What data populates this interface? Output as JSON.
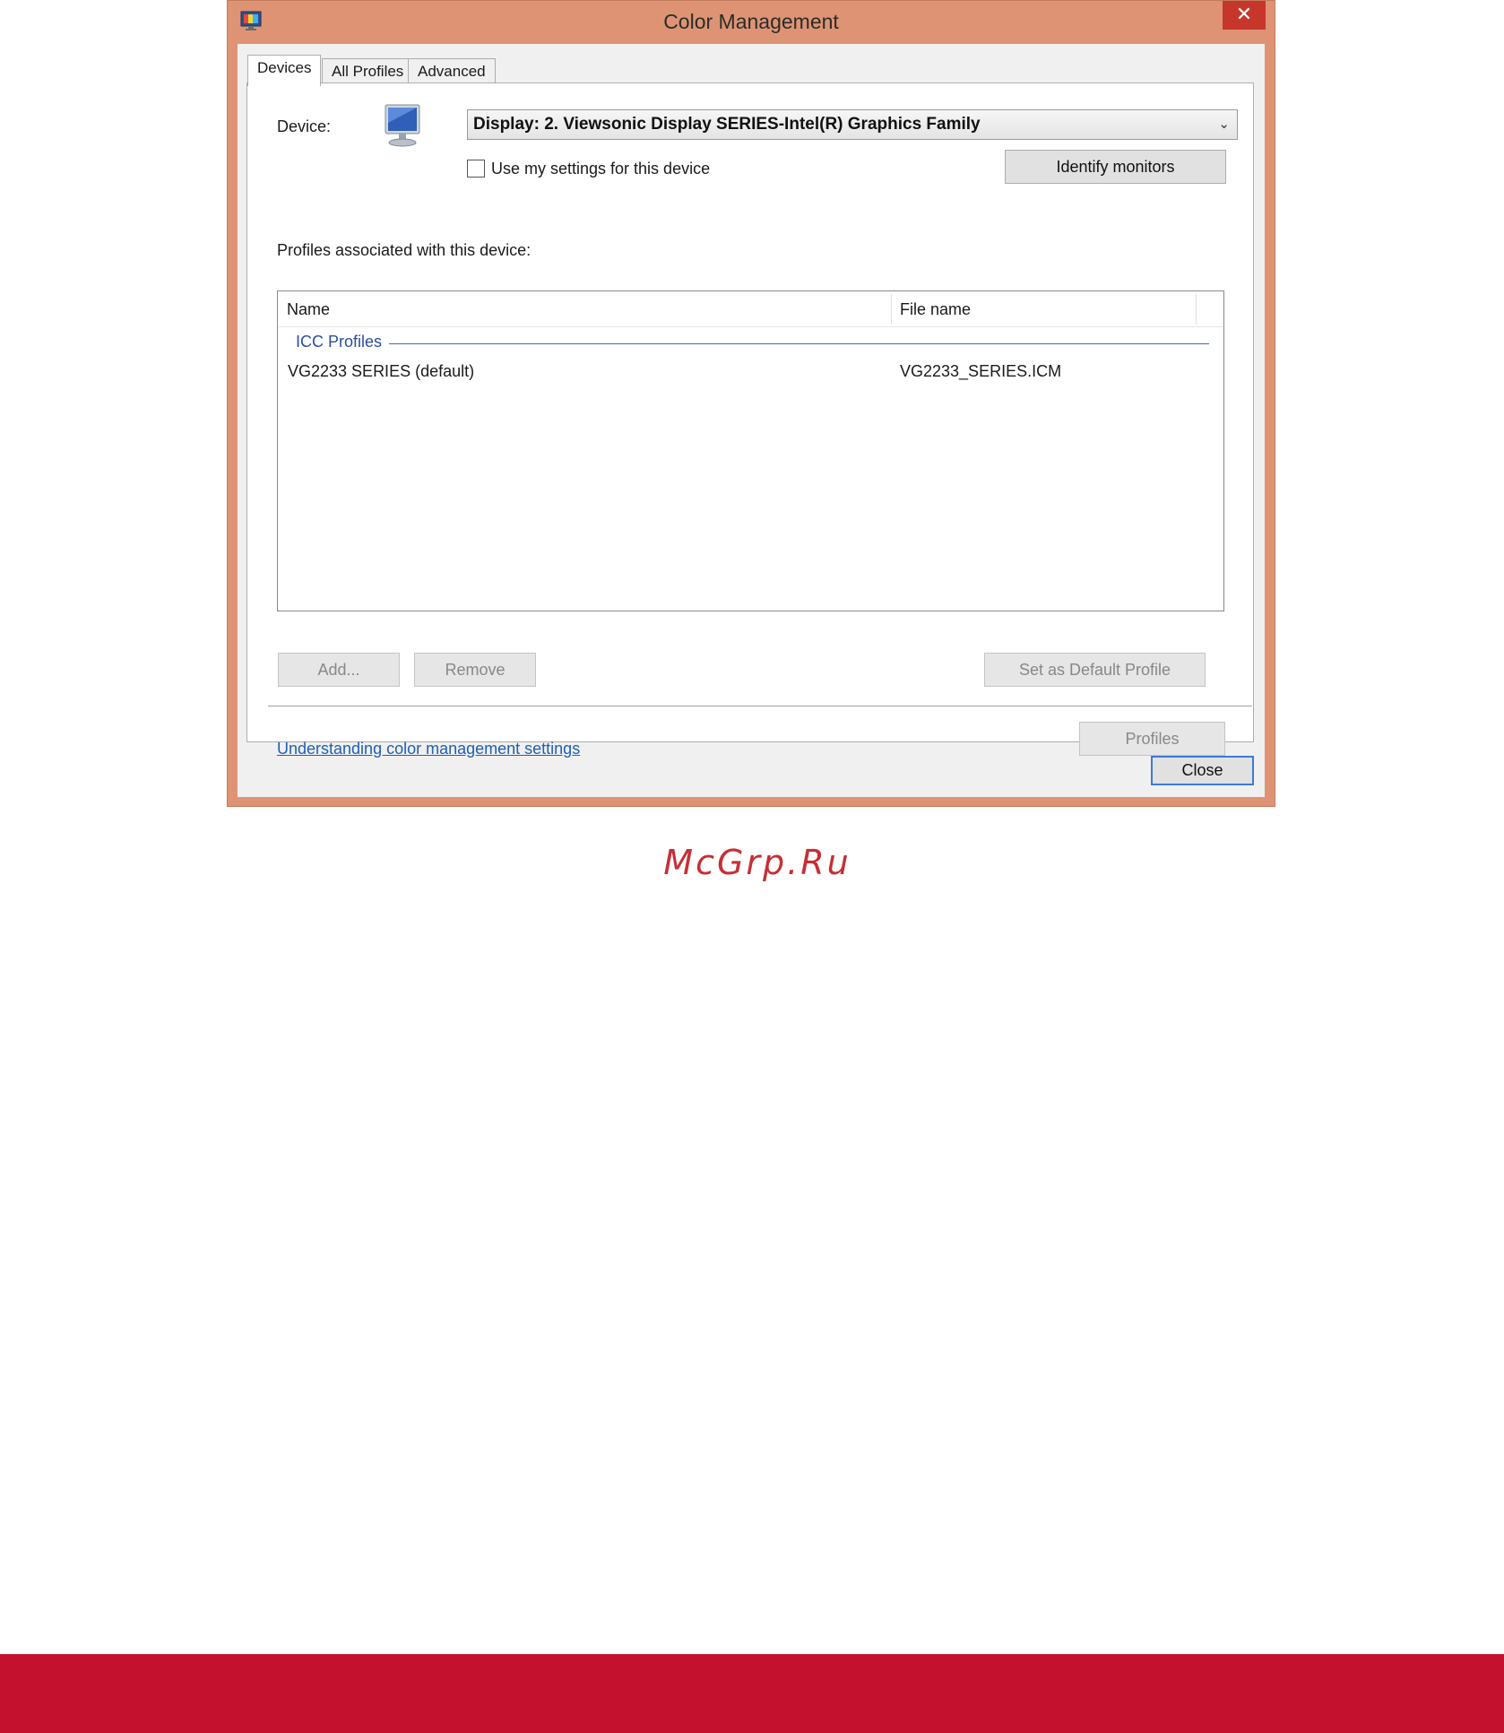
{
  "window": {
    "title": "Color Management",
    "close_glyph": "✕",
    "colors": {
      "title_bar": "#de9474",
      "close_button": "#c7362b"
    }
  },
  "tabs": [
    {
      "label": "Devices",
      "active": true
    },
    {
      "label": "All Profiles",
      "active": false
    },
    {
      "label": "Advanced",
      "active": false
    }
  ],
  "devices": {
    "device_label": "Device:",
    "device_icon": "monitor-icon",
    "device_value": "Display: 2. Viewsonic Display SERIES-Intel(R) Graphics Family",
    "use_my_settings_label": "Use my settings for this device",
    "use_my_settings_checked": false,
    "identify_button": "Identify monitors",
    "profiles_label": "Profiles associated with this device:",
    "table": {
      "columns": [
        "Name",
        "File name"
      ],
      "group": "ICC Profiles",
      "rows": [
        {
          "name": "VG2233 SERIES (default)",
          "file": "VG2233_SERIES.ICM"
        }
      ]
    },
    "add_button": "Add...",
    "remove_button": "Remove",
    "set_default_button": "Set as Default Profile",
    "help_link": "Understanding color management settings",
    "profiles_button": "Profiles"
  },
  "close_button": "Close",
  "watermark": "McGrp.Ru",
  "footer_color": "#c4122e"
}
